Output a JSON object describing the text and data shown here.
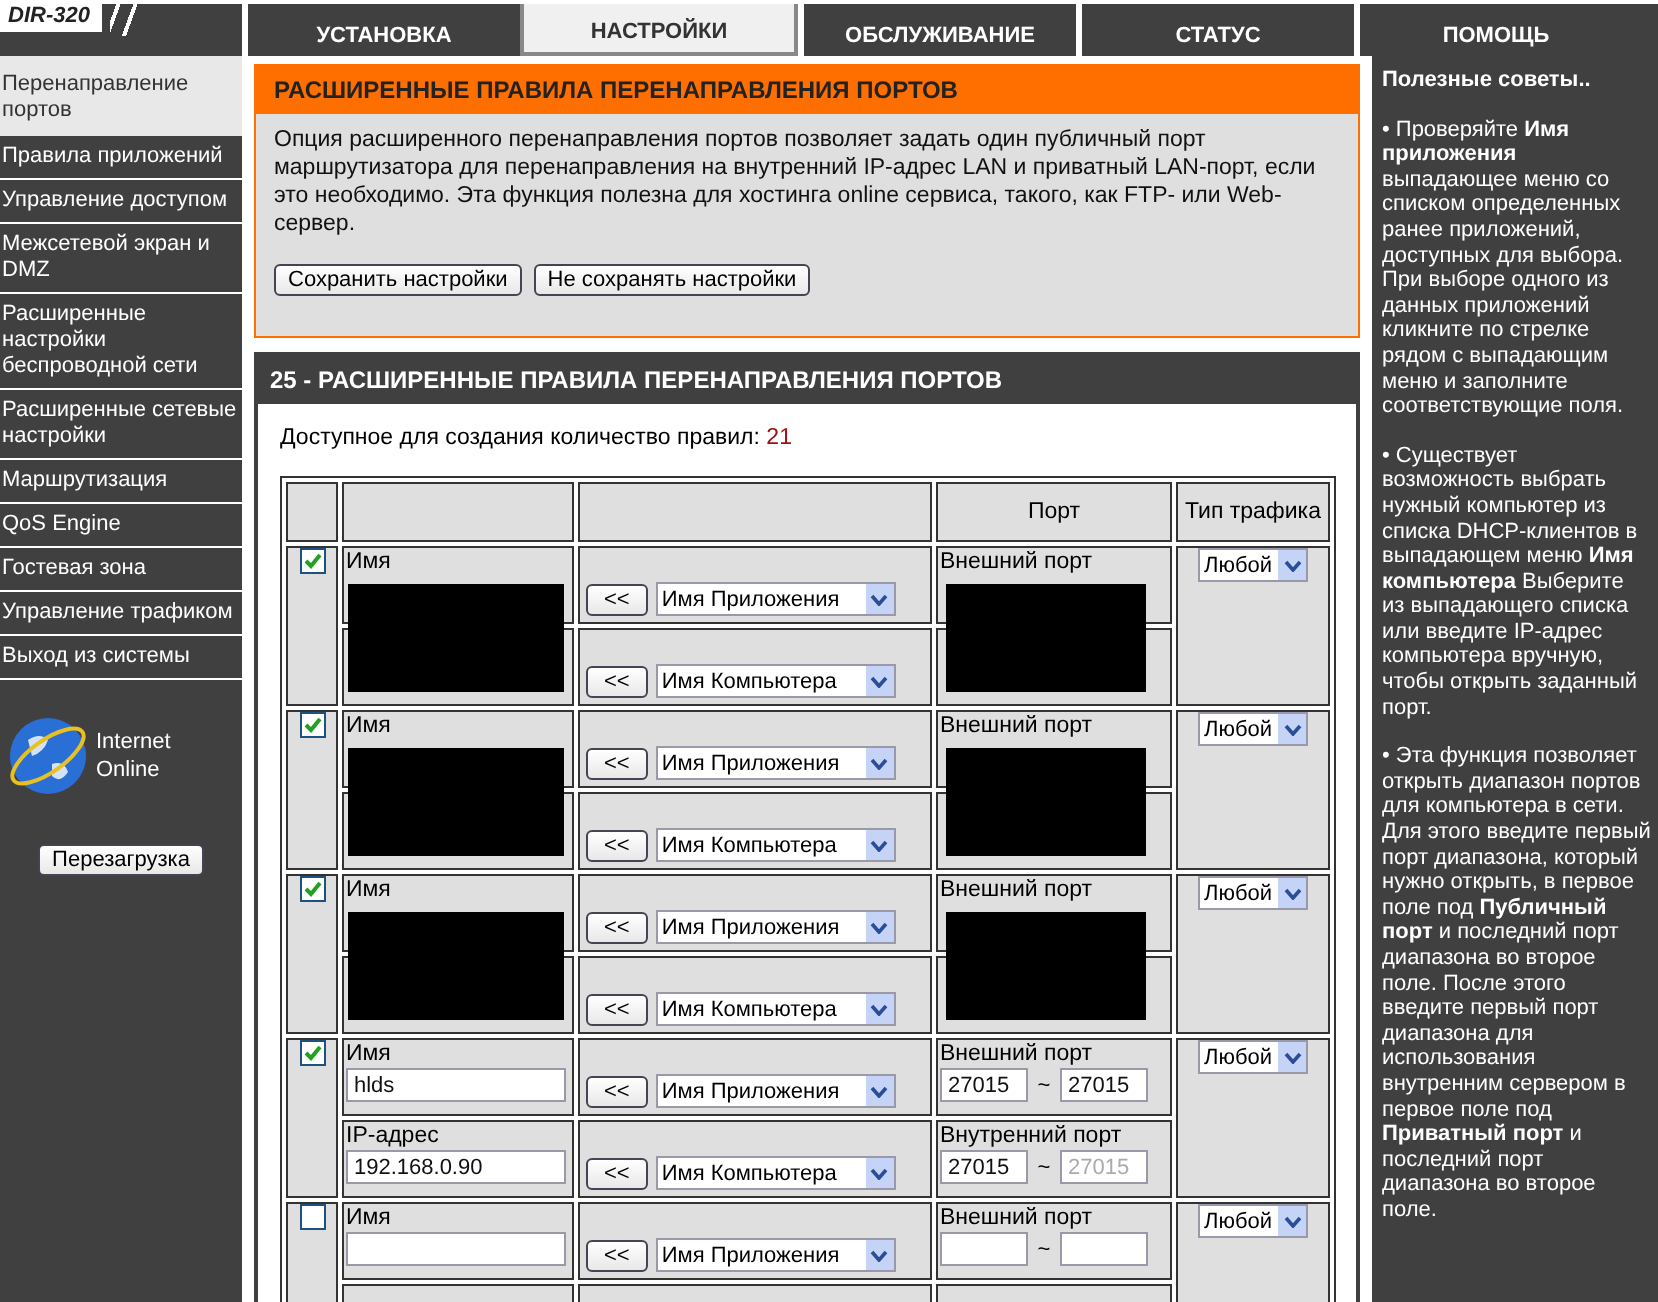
{
  "header": {
    "logo": "DIR-320",
    "tabs": [
      {
        "label": "УСТАНОВКА",
        "selected": false
      },
      {
        "label": "НАСТРОЙКИ",
        "selected": true
      },
      {
        "label": "ОБСЛУЖИВАНИЕ",
        "selected": false
      },
      {
        "label": "СТАТУС",
        "selected": false
      },
      {
        "label": "ПОМОЩЬ",
        "selected": false
      }
    ]
  },
  "sidebar": {
    "items": [
      {
        "label": "Перенаправление портов",
        "selected": true
      },
      {
        "label": "Правила приложений",
        "selected": false
      },
      {
        "label": "Управление доступом",
        "selected": false
      },
      {
        "label": "Межсетевой экран и DMZ",
        "selected": false
      },
      {
        "label": "Расширенные настройки беспроводной сети",
        "selected": false
      },
      {
        "label": "Расширенные сетевые настройки",
        "selected": false
      },
      {
        "label": "Маршрутизация",
        "selected": false
      },
      {
        "label": "QoS Engine",
        "selected": false
      },
      {
        "label": "Гостевая зона",
        "selected": false
      },
      {
        "label": "Управление трафиком",
        "selected": false
      },
      {
        "label": "Выход из системы",
        "selected": false
      }
    ],
    "status": "Internet Online",
    "reboot_button": "Перезагрузка"
  },
  "intro": {
    "title": "РАСШИРЕННЫЕ ПРАВИЛА ПЕРЕНАПРАВЛЕНИЯ ПОРТОВ",
    "text": "Опция расширенного перенаправления портов позволяет задать один публичный порт маршрутизатора для перенаправления на внутренний IP-адрес LAN и приватный LAN-порт, если это необходимо. Эта функция полезна для хостинга online сервиса, такого, как FTP- или Web-сервер.",
    "buttons": [
      "Сохранить настройки",
      "Не сохранять настройки"
    ]
  },
  "rules": {
    "title": "25 - РАСШИРЕННЫЕ ПРАВИЛА ПЕРЕНАПРАВЛЕНИЯ ПОРТОВ",
    "available_label": "Доступное для создания количество правил:",
    "available_count": "21",
    "port_header": "Порт",
    "traffic_header": "Тип трафика",
    "rows": [
      {
        "kind": "redacted",
        "enabled": true,
        "name_label": "Имя",
        "app_button": "<<",
        "app_select": "Имя Приложения",
        "computer_button": "<<",
        "computer_select": "Имя Компьютера",
        "external_label": "Внешний порт",
        "traffic": "Любой"
      },
      {
        "kind": "redacted",
        "enabled": true,
        "name_label": "Имя",
        "app_button": "<<",
        "app_select": "Имя Приложения",
        "computer_button": "<<",
        "computer_select": "Имя Компьютера",
        "external_label": "Внешний порт",
        "traffic": "Любой"
      },
      {
        "kind": "redacted",
        "enabled": true,
        "name_label": "Имя",
        "app_button": "<<",
        "app_select": "Имя Приложения",
        "computer_button": "<<",
        "computer_select": "Имя Компьютера",
        "external_label": "Внешний порт",
        "traffic": "Любой"
      },
      {
        "kind": "plain",
        "enabled": true,
        "name_label": "Имя",
        "name": "hlds",
        "ip_label": "IP-адрес",
        "ip": "192.168.0.90",
        "app_button": "<<",
        "app_select": "Имя Приложения",
        "computer_button": "<<",
        "computer_select": "Имя Компьютера",
        "external_label": "Внешний порт",
        "ext_from": "27015",
        "ext_sep": "~",
        "ext_to": "27015",
        "internal_label": "Внутренний порт",
        "int_from": "27015",
        "int_sep": "~",
        "int_to": "27015",
        "int_to_disabled": true,
        "traffic": "Любой"
      },
      {
        "kind": "plain",
        "enabled": false,
        "name_label": "Имя",
        "app_button": "<<",
        "app_select": "Имя Приложения",
        "external_label": "Внешний порт",
        "ext_sep": "~",
        "traffic": "Любой"
      }
    ]
  },
  "hints": {
    "title": "Полезные советы..",
    "tips": [
      "• Проверяйте **Имя приложения** выпадающее меню со списком определенных ранее приложений, доступных для выбора. При выборе одного из данных приложений кликните по стрелке рядом с выпадающим меню и заполните соответствующие поля.",
      "• Существует возможность выбрать нужный компьютер из списка DHCP-клиентов в выпадающем меню **Имя компьютера** Выберите из выпадающего списка или введите IP-адрес компьютера вручную, чтобы открыть заданный порт.",
      "• Эта функция позволяет открыть диапазон портов для компьютера в сети. Для этого введите первый порт диапазона, который нужно открыть, в первое поле под **Публичный порт** и последний порт диапазона во второе поле. После этого введите первый порт диапазона для использования внутренним сервером в первое поле под **Приватный порт** и последний порт диапазона во второе поле."
    ]
  }
}
